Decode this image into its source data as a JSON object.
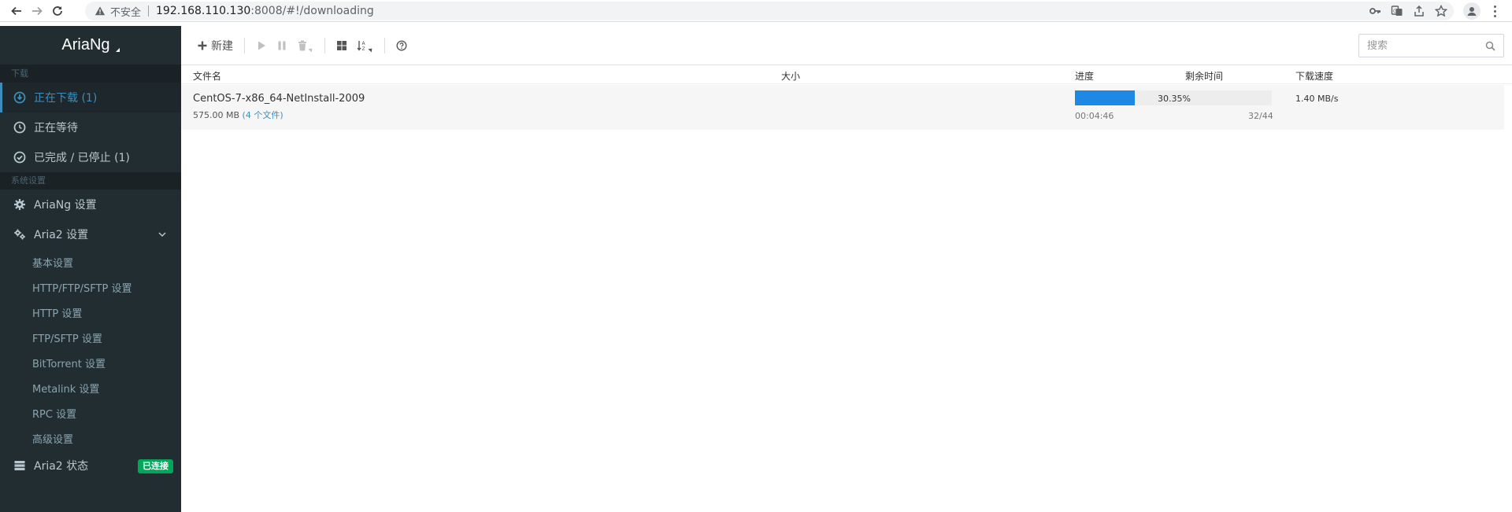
{
  "browser": {
    "insecure_label": "不安全",
    "url_host": "192.168.110.130",
    "url_path": ":8008/#!/downloading"
  },
  "sidebar": {
    "logo": "AriaNg",
    "section_download": "下载",
    "downloading": "正在下载 (1)",
    "waiting": "正在等待",
    "stopped": "已完成 / 已停止 (1)",
    "section_settings": "系统设置",
    "ariang_settings": "AriaNg 设置",
    "aria2_settings": "Aria2 设置",
    "sub_items": [
      "基本设置",
      "HTTP/FTP/SFTP 设置",
      "HTTP 设置",
      "FTP/SFTP 设置",
      "BitTorrent 设置",
      "Metalink 设置",
      "RPC 设置",
      "高级设置"
    ],
    "aria2_status": "Aria2 状态",
    "status_badge": "已连接"
  },
  "toolbar": {
    "new_label": "新建",
    "search_placeholder": "搜索"
  },
  "table": {
    "headers": {
      "name": "文件名",
      "size": "大小",
      "progress": "进度",
      "remaining": "剩余时间",
      "speed": "下载速度"
    }
  },
  "task": {
    "name": "CentOS-7-x86_64-NetInstall-2009",
    "size": "575.00 MB",
    "files": "(4 个文件)",
    "progress_pct": "30.35%",
    "progress_value": 0.3035,
    "remaining": "00:04:46",
    "connections": "32/44",
    "speed": "1.40 MB/s"
  },
  "colors": {
    "accent": "#3c8dbc",
    "progress": "#1e88e5",
    "badge": "#00a65a",
    "sidebar_bg": "#222d32"
  }
}
